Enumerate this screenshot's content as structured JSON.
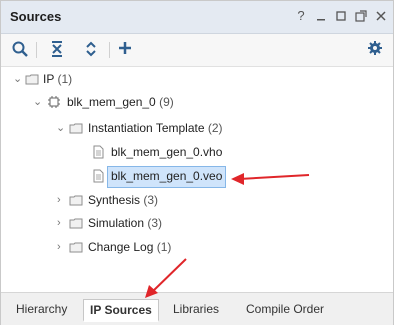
{
  "window": {
    "title": "Sources"
  },
  "toolbar": {
    "search_icon": "search-icon",
    "collapse_all_icon": "collapse-all-icon",
    "expand_all_icon": "expand-all-icon",
    "add_icon": "add-icon",
    "settings_icon": "gear-icon"
  },
  "tree": {
    "ip_group": {
      "label": "IP",
      "count": "(1)"
    },
    "ip_core": {
      "label": "blk_mem_gen_0",
      "count": "(9)"
    },
    "instantiation": {
      "label": "Instantiation Template",
      "count": "(2)"
    },
    "files": [
      {
        "label": "blk_mem_gen_0.vho"
      },
      {
        "label": "blk_mem_gen_0.veo"
      }
    ],
    "synthesis": {
      "label": "Synthesis",
      "count": "(3)"
    },
    "simulation": {
      "label": "Simulation",
      "count": "(3)"
    },
    "changelog": {
      "label": "Change Log",
      "count": "(1)"
    }
  },
  "tabs": [
    {
      "label": "Hierarchy"
    },
    {
      "label": "IP Sources"
    },
    {
      "label": "Libraries"
    },
    {
      "label": "Compile Order"
    }
  ],
  "colors": {
    "accent": "#2f5f8f",
    "annotation_arrow": "#e0262a",
    "selection": "#cfe4fb"
  }
}
